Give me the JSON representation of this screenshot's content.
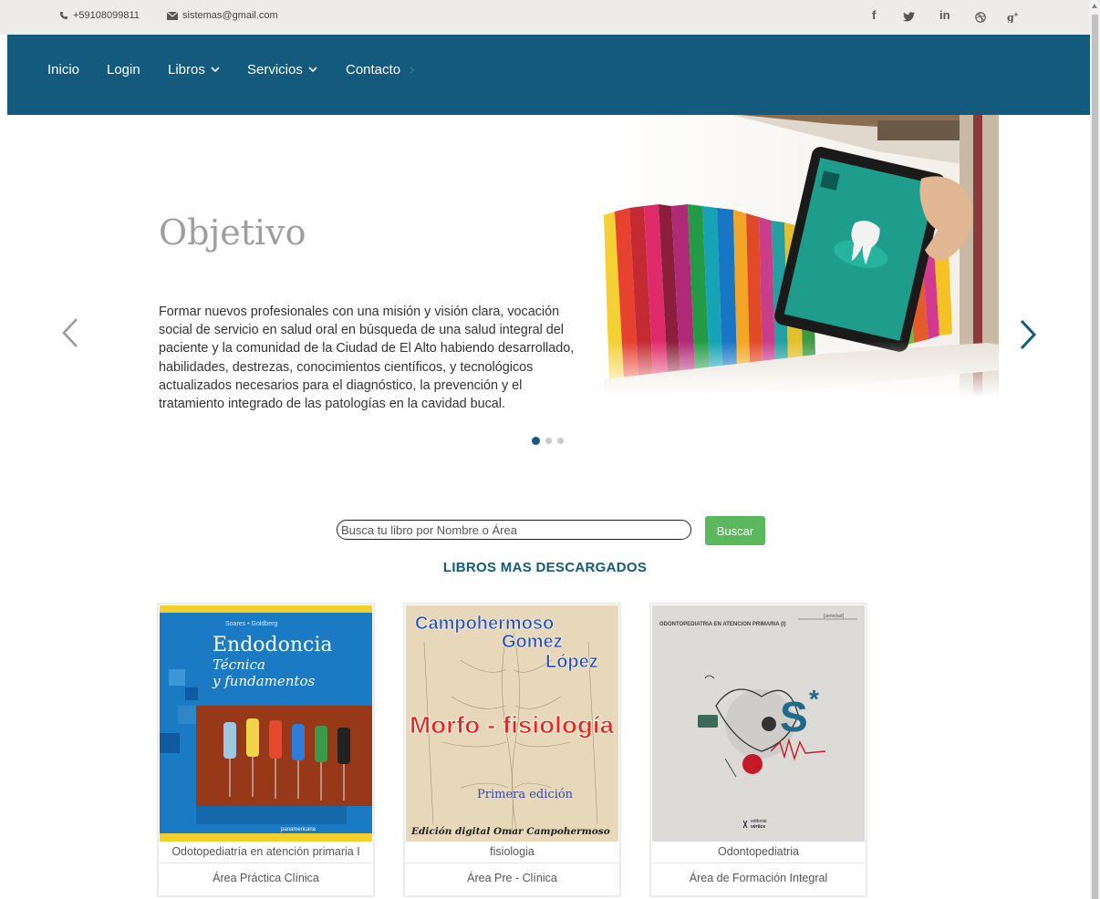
{
  "topbar": {
    "phone": "+59108099811",
    "email": "sistemas@gmail.com",
    "social": [
      "f",
      "in"
    ]
  },
  "nav": {
    "items": [
      {
        "label": "Inicio"
      },
      {
        "label": "Login"
      },
      {
        "label": "Libros"
      },
      {
        "label": "Servicios"
      },
      {
        "label": "Contacto"
      }
    ]
  },
  "hero": {
    "title": "Objetivo",
    "text": "Formar nuevos profesionales con una misión y visión clara, vocación social de servicio en salud oral en búsqueda de una salud integral del paciente y la comunidad de la Ciudad de El Alto habiendo desarrollado, habilidades, destrezas, conocimientos científicos, y tecnológicos actualizados necesarios para el diagnóstico, la prevención y el tratamiento integrado de las patologías en la cavidad bucal.",
    "slide_count": 3,
    "active_slide": 1
  },
  "search": {
    "placeholder": "Busca tu libro por Nombre o Área",
    "button": "Buscar"
  },
  "section_title": "LIBROS MAS DESCARGADOS",
  "books": [
    {
      "title": "Odotopediatría en atención primaria I",
      "area": "Área Práctica Clínica",
      "cover": {
        "authors": "Soares • Goldberg",
        "title": "Endodoncia",
        "subtitle1": "Técnica",
        "subtitle2": "y fundamentos",
        "publisher": "panamericana"
      }
    },
    {
      "title": "fisiologia",
      "area": "Área Pre - Clínica",
      "cover": {
        "name1": "Campohermoso",
        "name2": "Gomez",
        "name3": "López",
        "title": "Morfo - fisiología",
        "edition": "Primera edición",
        "footer": "Edición digital Omar Campohermoso"
      }
    },
    {
      "title": "Odontopediatria",
      "area": "Área de Formación Integral",
      "cover": {
        "header": "ODONTOPEDIATRIA EN ATENCION PRIMARIA (I)",
        "tag": "[seriedad]",
        "publisher1": "editorial",
        "publisher2": "vértice"
      }
    }
  ],
  "colors": {
    "nav": "#135a7c",
    "accent": "#5cb85c"
  }
}
